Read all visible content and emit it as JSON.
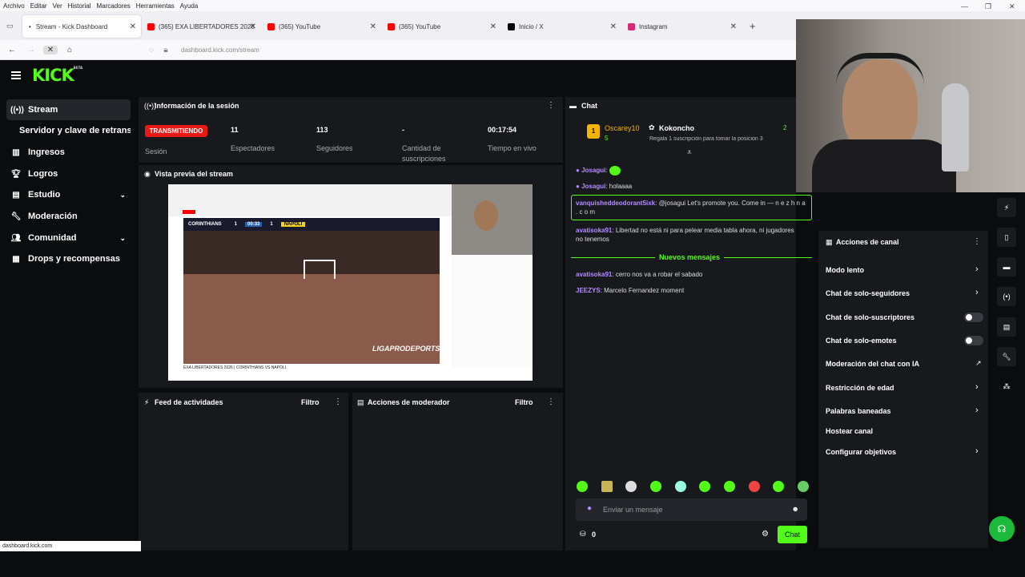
{
  "menu": [
    "Archivo",
    "Editar",
    "Ver",
    "Historial",
    "Marcadores",
    "Herramientas",
    "Ayuda"
  ],
  "tabs": [
    {
      "label": "Stream - Kick Dashboard",
      "color": "#53fc18"
    },
    {
      "label": "(365) EXA LIBERTADORES 2026",
      "color": "#ff0000"
    },
    {
      "label": "(365) YouTube",
      "color": "#ff0000"
    },
    {
      "label": "(365) YouTube",
      "color": "#ff0000"
    },
    {
      "label": "Inicio / X",
      "color": "#000000"
    },
    {
      "label": "Instagram",
      "color": "#d62976"
    }
  ],
  "url": "dashboard.kick.com/stream",
  "status_url": "dashboard.kick.com",
  "logo": "KICK",
  "logo_sup": "BETA",
  "sidebar": {
    "items": [
      {
        "label": "Stream",
        "icon": "broadcast-icon"
      },
      {
        "label": "Servidor y clave de retransm",
        "icon": ""
      },
      {
        "label": "Ingresos",
        "icon": "chart-icon"
      },
      {
        "label": "Logros",
        "icon": "trophy-icon"
      },
      {
        "label": "Estudio",
        "icon": "studio-icon"
      },
      {
        "label": "Moderación",
        "icon": "wrench-icon"
      },
      {
        "label": "Comunidad",
        "icon": "people-icon"
      },
      {
        "label": "Drops y recompensas",
        "icon": "gift-icon"
      }
    ]
  },
  "session": {
    "title": "Información de la sesión",
    "live_badge": "TRANSMITIENDO",
    "session_label": "Sesión",
    "stats": [
      {
        "value": "11",
        "label": "Espectadores"
      },
      {
        "value": "113",
        "label": "Seguidores"
      },
      {
        "value": "-",
        "label": "Cantidad de suscripciones"
      },
      {
        "value": "00:17:54",
        "label": "Tiempo en vivo"
      }
    ]
  },
  "preview": {
    "title": "Vista previa del stream",
    "score_left": "CORINTHIANS",
    "score_left_goals": "1",
    "score_time": "00:33",
    "score_right_goals": "1",
    "score_right": "NAPOLI",
    "caption": "EXA LIBERTADORES 2026 | CORINTHIANS VS NAPOLI",
    "watermark": "LIGAPRODEPORTS"
  },
  "feed": {
    "title": "Feed de actividades",
    "filter": "Filtro"
  },
  "modactions": {
    "title": "Acciones de moderador",
    "filter": "Filtro"
  },
  "chat": {
    "title": "Chat",
    "pinned_user": "Oscarey10",
    "pinned_rank": "5",
    "gifter": "Kokoncho",
    "gift_count": "2",
    "gift_text": "Regala 1 suscripción para tomar la posición 3",
    "messages": [
      {
        "user": "Josagui",
        "text": ""
      },
      {
        "user": "Josagui",
        "text": "holaaaa"
      },
      {
        "user": "vanquisheddeodorant5ixk",
        "text": "@josagui Let's promote you. Come in — n e z h n a . c o m"
      },
      {
        "user": "avatisoka91",
        "text": "Libertad no está ni para pelear media tabla ahora, ni jugadores no tenemos"
      },
      {
        "user": "avatisoka91",
        "text": "cerro nos va a robar el sabado"
      },
      {
        "user": "JEEZYS",
        "text": "Marcelo Fernandez moment"
      }
    ],
    "new_messages": "Nuevos mensajes",
    "input_placeholder": "Enviar un mensaje",
    "points": "0",
    "send": "Chat"
  },
  "channel_actions": {
    "title": "Acciones de canal",
    "items": [
      {
        "label": "Modo lento",
        "type": "chevron"
      },
      {
        "label": "Chat de solo-seguidores",
        "type": "chevron"
      },
      {
        "label": "Chat de solo-suscriptores",
        "type": "toggle"
      },
      {
        "label": "Chat de solo-emotes",
        "type": "toggle"
      },
      {
        "label": "Moderación del chat con IA",
        "type": "external"
      },
      {
        "label": "Restricción de edad",
        "type": "chevron"
      },
      {
        "label": "Palabras baneadas",
        "type": "chevron"
      },
      {
        "label": "Hostear canal",
        "type": "none"
      },
      {
        "label": "Configurar objetivos",
        "type": "chevron"
      }
    ]
  },
  "colors": {
    "brand": "#53fc18",
    "live": "#e91916",
    "panel": "#18191d",
    "bg": "#0b0c0e"
  }
}
